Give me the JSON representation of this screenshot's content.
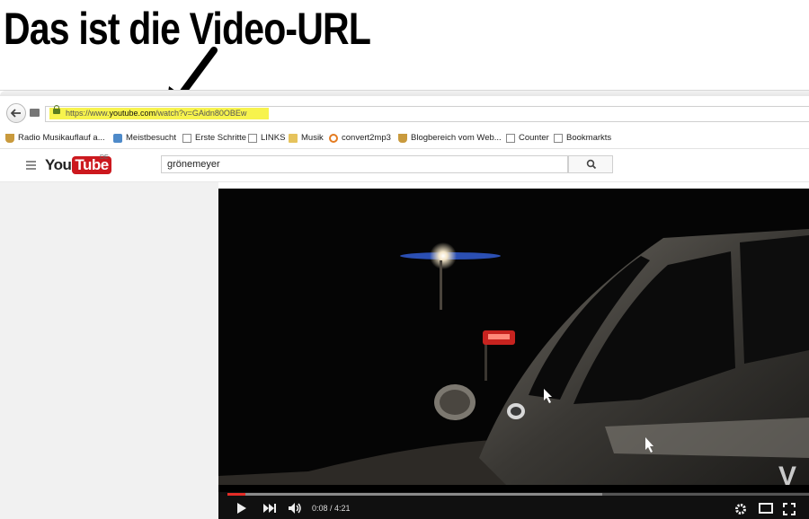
{
  "caption": "Das ist die Video-URL",
  "browser": {
    "url_scheme": "https://www.",
    "url_domain": "youtube.com",
    "url_path": "/watch?v=GAidn80OBEw",
    "bookmarks": [
      {
        "label": "Radio Musikauflauf a...",
        "icon": "cup-icon"
      },
      {
        "label": "Meistbesucht",
        "icon": "star-page-icon"
      },
      {
        "label": "Erste Schritte",
        "icon": "page-icon"
      },
      {
        "label": "LINKS",
        "icon": "page-icon"
      },
      {
        "label": "Musik",
        "icon": "folder-icon"
      },
      {
        "label": "convert2mp3",
        "icon": "convert-icon"
      },
      {
        "label": "Blogbereich vom Web...",
        "icon": "cup-icon"
      },
      {
        "label": "Counter",
        "icon": "page-icon"
      },
      {
        "label": "Bookmarkts",
        "icon": "page-icon"
      }
    ]
  },
  "youtube": {
    "logo_you": "You",
    "logo_tube": "Tube",
    "country": "DE",
    "search_value": "grönemeyer"
  },
  "player": {
    "time": "0:08 / 4:21",
    "progress_fraction": 0.031,
    "buffered_fraction": 0.645,
    "watermark": "V"
  },
  "colors": {
    "highlight": "#f7f34d",
    "youtube_red": "#cc181e",
    "progress_red": "#e52d27"
  }
}
